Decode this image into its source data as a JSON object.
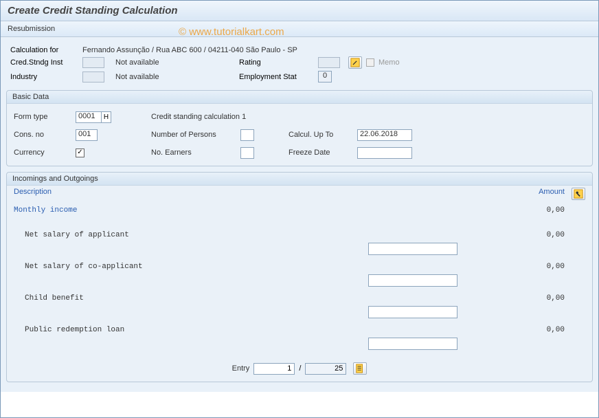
{
  "title": "Create Credit Standing Calculation",
  "menu": {
    "resubmission": "Resubmission"
  },
  "watermark": "© www.tutorialkart.com",
  "header": {
    "calcfor_label": "Calculation for",
    "calcfor_value": "Fernando Assunção / Rua ABC 600 / 04211-040 São Paulo - SP",
    "cred_inst_label": "Cred.Stndg Inst",
    "cred_inst_value": "",
    "cred_inst_text": "Not available",
    "rating_label": "Rating",
    "rating_value": "",
    "memo_label": "Memo",
    "industry_label": "Industry",
    "industry_value": "",
    "industry_text": "Not available",
    "emp_stat_label": "Employment Stat",
    "emp_stat_value": "0"
  },
  "basic": {
    "title": "Basic Data",
    "form_type_label": "Form type",
    "form_type_value": "0001",
    "form_type_suffix": "H",
    "form_type_text": "Credit standing calculation 1",
    "cons_no_label": "Cons. no",
    "cons_no_value": "001",
    "persons_label": "Number of Persons",
    "persons_value": "",
    "calc_upto_label": "Calcul. Up To",
    "calc_upto_value": "22.06.2018",
    "currency_label": "Currency",
    "currency_checked": true,
    "earners_label": "No. Earners",
    "earners_value": "",
    "freeze_label": "Freeze Date",
    "freeze_value": ""
  },
  "io": {
    "title": "Incomings and Outgoings",
    "desc_header": "Description",
    "amount_header": "Amount",
    "rows": [
      {
        "label": "Monthly income",
        "amount": "0,00",
        "category": true
      },
      {
        "label": "Net salary of applicant",
        "amount": "0,00",
        "input": true
      },
      {
        "label": "Net salary of co-applicant",
        "amount": "0,00",
        "input": true
      },
      {
        "label": "Child benefit",
        "amount": "0,00",
        "input": true
      },
      {
        "label": "Public redemption loan",
        "amount": "0,00",
        "input": true
      }
    ]
  },
  "pager": {
    "label": "Entry",
    "current": "1",
    "sep": "/",
    "total": "25"
  }
}
